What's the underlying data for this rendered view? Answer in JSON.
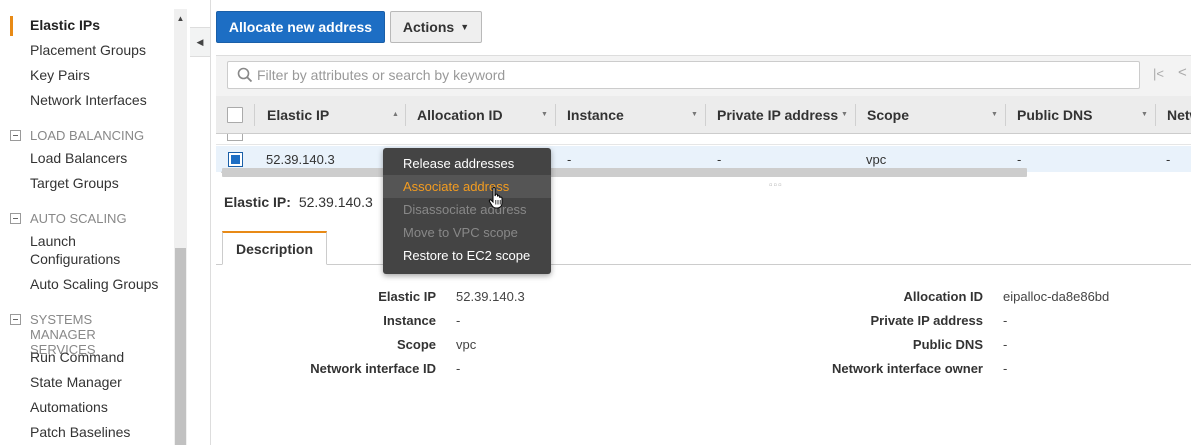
{
  "sidebar": {
    "items": [
      {
        "label": "Elastic IPs",
        "active": true
      },
      {
        "label": "Placement Groups"
      },
      {
        "label": "Key Pairs"
      },
      {
        "label": "Network Interfaces"
      }
    ],
    "sections": [
      {
        "title": "LOAD BALANCING",
        "items": [
          "Load Balancers",
          "Target Groups"
        ]
      },
      {
        "title": "AUTO SCALING",
        "items": [
          "Launch Configurations",
          "Auto Scaling Groups"
        ]
      },
      {
        "title": "SYSTEMS MANAGER SERVICES",
        "items": [
          "Run Command",
          "State Manager",
          "Automations",
          "Patch Baselines"
        ]
      }
    ]
  },
  "toolbar": {
    "allocate_label": "Allocate new address",
    "actions_label": "Actions"
  },
  "search": {
    "placeholder": "Filter by attributes or search by keyword"
  },
  "table": {
    "columns": [
      "Elastic IP",
      "Allocation ID",
      "Instance",
      "Private IP address",
      "Scope",
      "Public DNS",
      "Netw"
    ],
    "row": {
      "elastic_ip": "52.39.140.3",
      "instance": "-",
      "private_ip": "-",
      "scope": "vpc",
      "public_dns": "-",
      "network": "-"
    }
  },
  "context_menu": {
    "items": [
      {
        "label": "Release addresses",
        "state": "normal"
      },
      {
        "label": "Associate address",
        "state": "hover"
      },
      {
        "label": "Disassociate address",
        "state": "disabled"
      },
      {
        "label": "Move to VPC scope",
        "state": "disabled"
      },
      {
        "label": "Restore to EC2 scope",
        "state": "normal"
      }
    ]
  },
  "detail": {
    "heading_label": "Elastic IP:",
    "heading_value": "52.39.140.3",
    "tab": "Description",
    "left_fields": [
      {
        "label": "Elastic IP",
        "value": "52.39.140.3"
      },
      {
        "label": "Instance",
        "value": "-"
      },
      {
        "label": "Scope",
        "value": "vpc"
      },
      {
        "label": "Network interface ID",
        "value": "-"
      }
    ],
    "right_fields": [
      {
        "label": "Allocation ID",
        "value": "eipalloc-da8e86bd"
      },
      {
        "label": "Private IP address",
        "value": "-"
      },
      {
        "label": "Public DNS",
        "value": "-"
      },
      {
        "label": "Network interface owner",
        "value": "-"
      }
    ]
  },
  "colors": {
    "accent_orange": "#e88a16",
    "primary_blue": "#1d6ec4",
    "menu_bg": "#444444",
    "menu_hover_text": "#f39c20"
  }
}
